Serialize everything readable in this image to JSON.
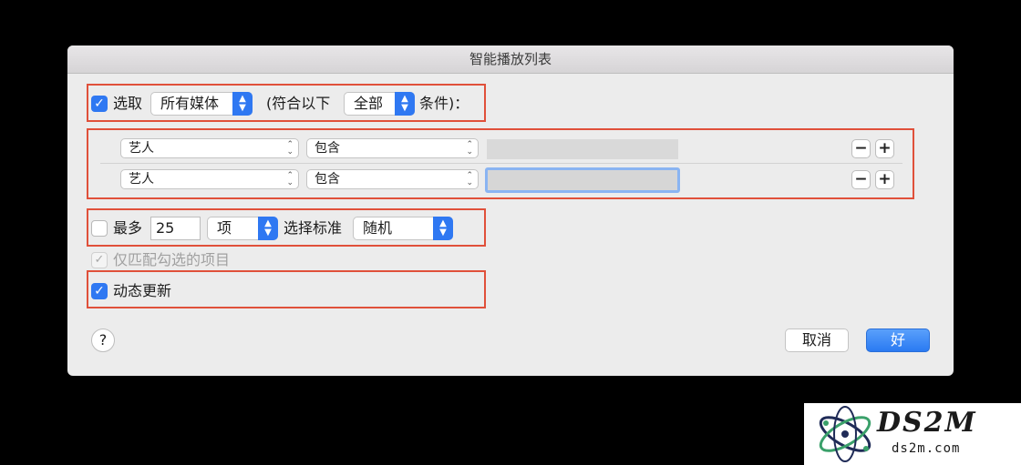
{
  "dialog": {
    "title": "智能播放列表"
  },
  "select_row": {
    "checked": true,
    "label": "选取",
    "media_value": "所有媒体",
    "prefix": "(符合以下",
    "match_value": "全部",
    "suffix": "条件)："
  },
  "rules": [
    {
      "field": "艺人",
      "operator": "包含",
      "value": ""
    },
    {
      "field": "艺人",
      "operator": "包含",
      "value": ""
    }
  ],
  "rule_buttons": {
    "remove": "−",
    "add": "+"
  },
  "limit_row": {
    "checked": false,
    "label": "最多",
    "count": "25",
    "unit": "项",
    "criteria_label": "选择标准",
    "criteria_value": "随机"
  },
  "match_checked_only": {
    "checked": true,
    "disabled": true,
    "label": "仅匹配勾选的项目"
  },
  "live_update": {
    "checked": true,
    "label": "动态更新"
  },
  "buttons": {
    "help": "?",
    "cancel": "取消",
    "ok": "好"
  },
  "watermark": {
    "logo_text": "DS2M",
    "domain": "ds2m.com"
  },
  "colors": {
    "accent": "#2f78f2",
    "highlight_box": "#e0503a"
  }
}
